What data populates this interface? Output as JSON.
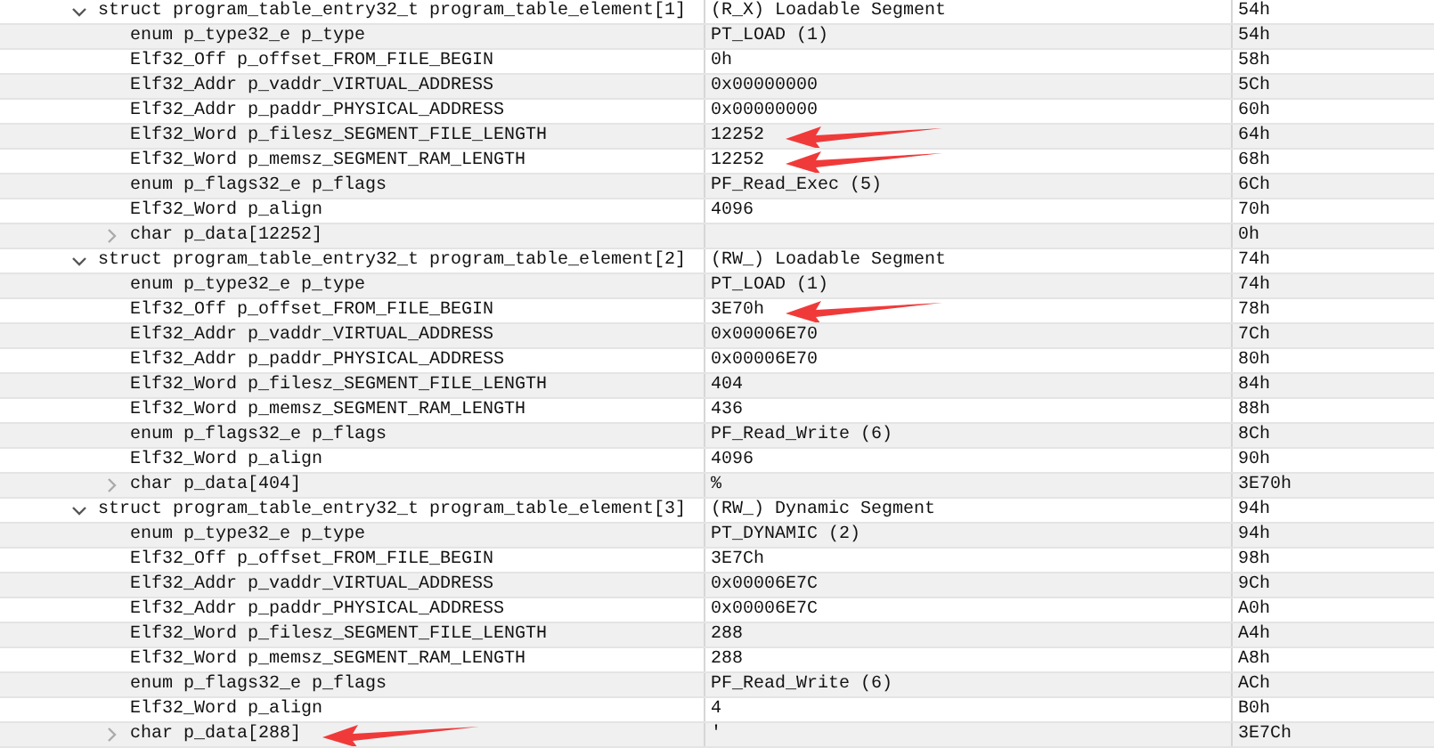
{
  "rows": [
    {
      "name": "struct program_table_entry32_t program_table_element[1]",
      "value": "(R_X) Loadable Segment",
      "start": "54h",
      "expanded": true,
      "children": [
        {
          "name": "enum p_type32_e p_type",
          "value": "PT_LOAD (1)",
          "start": "54h"
        },
        {
          "name": "Elf32_Off p_offset_FROM_FILE_BEGIN",
          "value": "0h",
          "start": "58h"
        },
        {
          "name": "Elf32_Addr p_vaddr_VIRTUAL_ADDRESS",
          "value": "0x00000000",
          "start": "5Ch"
        },
        {
          "name": "Elf32_Addr p_paddr_PHYSICAL_ADDRESS",
          "value": "0x00000000",
          "start": "60h"
        },
        {
          "name": "Elf32_Word p_filesz_SEGMENT_FILE_LENGTH",
          "value": "12252",
          "start": "64h",
          "value_arrow": true
        },
        {
          "name": "Elf32_Word p_memsz_SEGMENT_RAM_LENGTH",
          "value": "12252",
          "start": "68h",
          "value_arrow": true
        },
        {
          "name": "enum p_flags32_e p_flags",
          "value": "PF_Read_Exec (5)",
          "start": "6Ch"
        },
        {
          "name": "Elf32_Word p_align",
          "value": "4096",
          "start": "70h"
        },
        {
          "name": "char p_data[12252]",
          "start": "0h",
          "expanded": false
        }
      ]
    },
    {
      "name": "struct program_table_entry32_t program_table_element[2]",
      "value": "(RW_) Loadable Segment",
      "start": "74h",
      "expanded": true,
      "children": [
        {
          "name": "enum p_type32_e p_type",
          "value": "PT_LOAD (1)",
          "start": "74h"
        },
        {
          "name": "Elf32_Off p_offset_FROM_FILE_BEGIN",
          "value": "3E70h",
          "start": "78h",
          "value_arrow": true
        },
        {
          "name": "Elf32_Addr p_vaddr_VIRTUAL_ADDRESS",
          "value": "0x00006E70",
          "start": "7Ch"
        },
        {
          "name": "Elf32_Addr p_paddr_PHYSICAL_ADDRESS",
          "value": "0x00006E70",
          "start": "80h"
        },
        {
          "name": "Elf32_Word p_filesz_SEGMENT_FILE_LENGTH",
          "value": "404",
          "start": "84h"
        },
        {
          "name": "Elf32_Word p_memsz_SEGMENT_RAM_LENGTH",
          "value": "436",
          "start": "88h"
        },
        {
          "name": "enum p_flags32_e p_flags",
          "value": "PF_Read_Write (6)",
          "start": "8Ch"
        },
        {
          "name": "Elf32_Word p_align",
          "value": "4096",
          "start": "90h"
        },
        {
          "name": "char p_data[404]",
          "value": "%",
          "start": "3E70h",
          "expanded": false
        }
      ]
    },
    {
      "name": "struct program_table_entry32_t program_table_element[3]",
      "value": "(RW_) Dynamic Segment",
      "start": "94h",
      "expanded": true,
      "children": [
        {
          "name": "enum p_type32_e p_type",
          "value": "PT_DYNAMIC (2)",
          "start": "94h"
        },
        {
          "name": "Elf32_Off p_offset_FROM_FILE_BEGIN",
          "value": "3E7Ch",
          "start": "98h"
        },
        {
          "name": "Elf32_Addr p_vaddr_VIRTUAL_ADDRESS",
          "value": "0x00006E7C",
          "start": "9Ch"
        },
        {
          "name": "Elf32_Addr p_paddr_PHYSICAL_ADDRESS",
          "value": "0x00006E7C",
          "start": "A0h"
        },
        {
          "name": "Elf32_Word p_filesz_SEGMENT_FILE_LENGTH",
          "value": "288",
          "start": "A4h"
        },
        {
          "name": "Elf32_Word p_memsz_SEGMENT_RAM_LENGTH",
          "value": "288",
          "start": "A8h"
        },
        {
          "name": "enum p_flags32_e p_flags",
          "value": "PF_Read_Write (6)",
          "start": "ACh"
        },
        {
          "name": "Elf32_Word p_align",
          "value": "4",
          "start": "B0h"
        },
        {
          "name": "char p_data[288]",
          "value": "'",
          "start": "3E7Ch",
          "expanded": false,
          "name_arrow": true
        }
      ]
    }
  ]
}
